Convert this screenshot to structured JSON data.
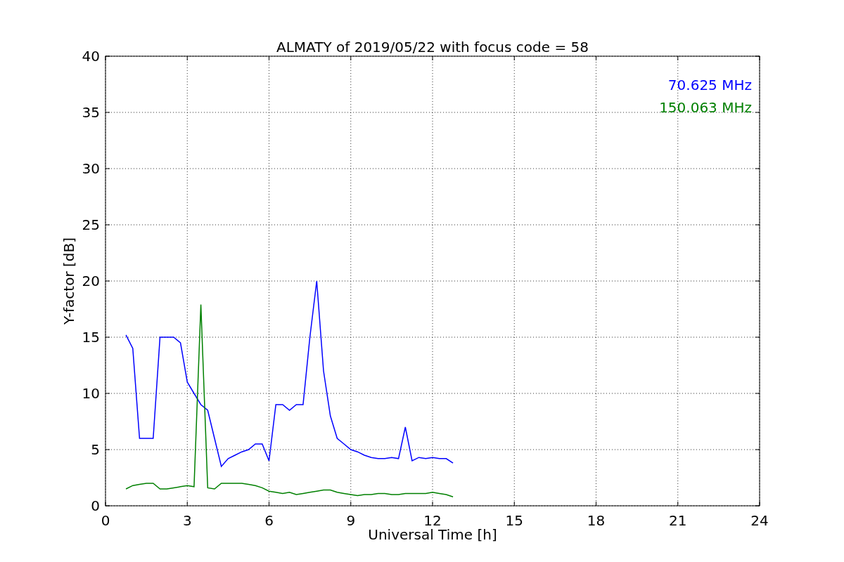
{
  "chart_data": {
    "type": "line",
    "title": "ALMATY of 2019/05/22 with focus code = 58",
    "xlabel": "Universal Time [h]",
    "ylabel": "Y-factor [dB]",
    "x": [
      0.75,
      1.0,
      1.25,
      1.5,
      1.75,
      2.0,
      2.25,
      2.5,
      2.75,
      3.0,
      3.25,
      3.5,
      3.75,
      4.0,
      4.25,
      4.5,
      4.75,
      5.0,
      5.25,
      5.5,
      5.75,
      6.0,
      6.25,
      6.5,
      6.75,
      7.0,
      7.25,
      7.5,
      7.75,
      8.0,
      8.25,
      8.5,
      8.75,
      9.0,
      9.25,
      9.5,
      9.75,
      10.0,
      10.25,
      10.5,
      10.75,
      11.0,
      11.25,
      11.5,
      11.75,
      12.0,
      12.25,
      12.5,
      12.75
    ],
    "series": [
      {
        "name": "70.625 MHz",
        "color": "#0000ff",
        "values": [
          15.2,
          14,
          6,
          6,
          6,
          15,
          15,
          15,
          14.5,
          11,
          10,
          9,
          8.5,
          6,
          3.5,
          4.2,
          4.5,
          4.8,
          5,
          5.5,
          5.5,
          4,
          9,
          9,
          8.5,
          9,
          9,
          15,
          20,
          12,
          8,
          6,
          5.5,
          5,
          4.8,
          4.5,
          4.3,
          4.2,
          4.2,
          4.3,
          4.2,
          7,
          4,
          4.3,
          4.2,
          4.3,
          4.2,
          4.2,
          3.8
        ]
      },
      {
        "name": "150.063 MHz",
        "color": "#008000",
        "values": [
          1.5,
          1.8,
          1.9,
          2,
          2,
          1.5,
          1.5,
          1.6,
          1.7,
          1.8,
          1.7,
          17.9,
          1.6,
          1.5,
          2,
          2,
          2,
          2,
          1.9,
          1.8,
          1.6,
          1.3,
          1.2,
          1.1,
          1.2,
          1,
          1.1,
          1.2,
          1.3,
          1.4,
          1.4,
          1.2,
          1.1,
          1,
          0.9,
          1,
          1,
          1.1,
          1.1,
          1,
          1,
          1.1,
          1.1,
          1.1,
          1.1,
          1.2,
          1.1,
          1,
          0.8
        ]
      }
    ],
    "grid": true,
    "xlim": [
      0,
      24
    ],
    "ylim": [
      0,
      40
    ],
    "xticks": [
      0,
      3,
      6,
      9,
      12,
      15,
      18,
      21,
      24
    ],
    "yticks": [
      0,
      5,
      10,
      15,
      20,
      25,
      30,
      35,
      40
    ]
  }
}
